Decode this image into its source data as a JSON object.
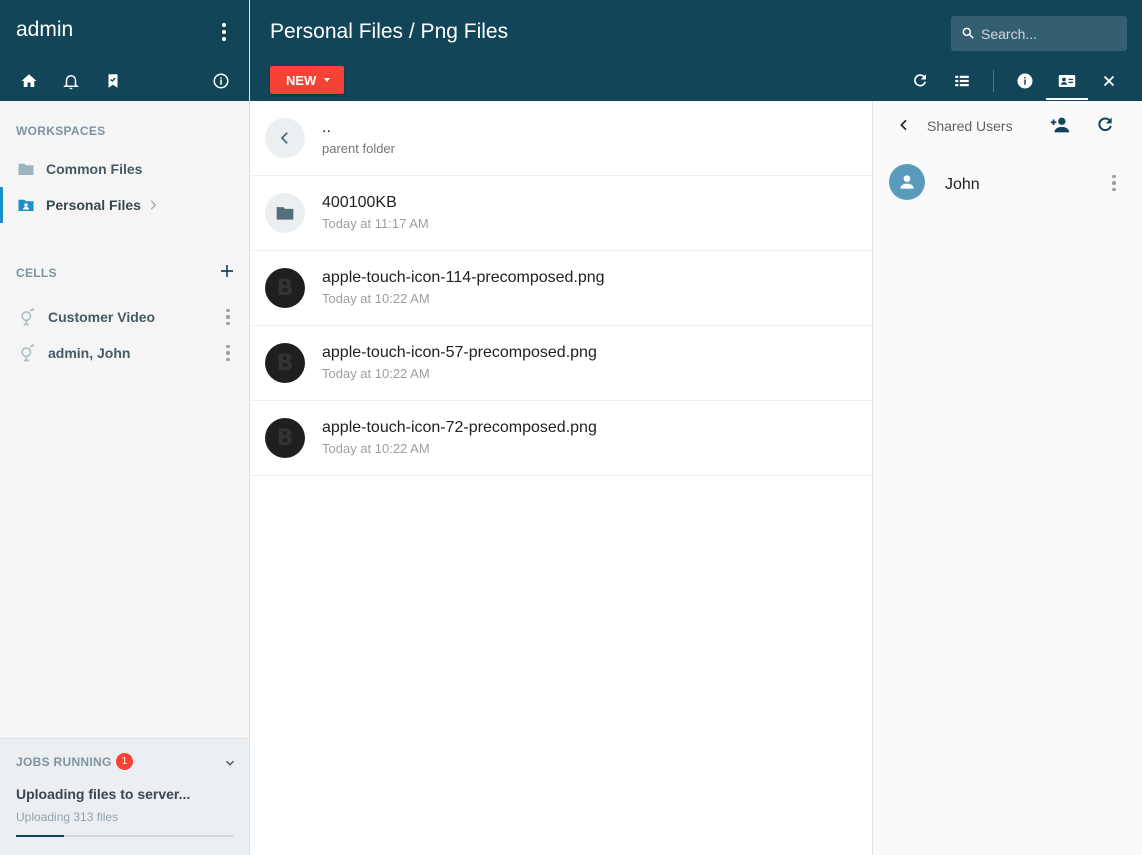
{
  "user": {
    "name": "admin"
  },
  "sidebar": {
    "header_icons": [
      "home-icon",
      "bell-icon",
      "bookmark-icon",
      "info-icon"
    ],
    "workspaces_title": "WORKSPACES",
    "workspaces": [
      {
        "label": "Common Files",
        "icon": "folder-icon",
        "active": false
      },
      {
        "label": "Personal Files",
        "icon": "person-folder-icon",
        "active": true
      }
    ],
    "cells_title": "CELLS",
    "cells": [
      {
        "label": "Customer Video",
        "icon": "cell-icon"
      },
      {
        "label": "admin, John",
        "icon": "cell-icon"
      }
    ]
  },
  "jobs": {
    "title": "JOBS RUNNING",
    "count": "1",
    "main": "Uploading files to server...",
    "sub": "Uploading 313 files",
    "progress": 0.22
  },
  "header": {
    "breadcrumb": "Personal Files / Png Files",
    "search_placeholder": "Search...",
    "new_label": "NEW",
    "toolbar_icons": [
      "refresh-icon",
      "list-view-icon",
      "info-icon",
      "shared-users-icon",
      "close-icon"
    ]
  },
  "files": [
    {
      "name": "..",
      "meta": "parent folder",
      "icon": "back-icon"
    },
    {
      "name": "400100KB",
      "meta": "Today at 11:17 AM",
      "icon": "folder-icon"
    },
    {
      "name": "apple-touch-icon-114-precomposed.png",
      "meta": "Today at 10:22 AM",
      "icon": "image-thumb"
    },
    {
      "name": "apple-touch-icon-57-precomposed.png",
      "meta": "Today at 10:22 AM",
      "icon": "image-thumb"
    },
    {
      "name": "apple-touch-icon-72-precomposed.png",
      "meta": "Today at 10:22 AM",
      "icon": "image-thumb"
    }
  ],
  "right_panel": {
    "title": "Shared Users",
    "users": [
      {
        "name": "John"
      }
    ]
  },
  "colors": {
    "header_bg": "#134559",
    "accent_red": "#f44336",
    "active_blue": "#1b8fc7",
    "user_avatar": "#5a9abb"
  }
}
